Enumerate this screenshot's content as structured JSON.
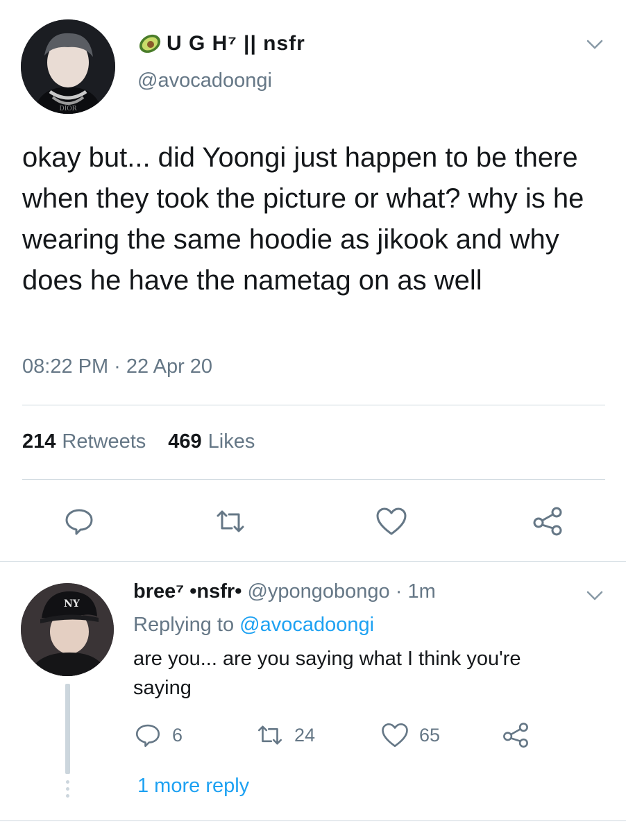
{
  "main_tweet": {
    "display_name": "U G H⁷ || nsfr",
    "handle": "@avocadoongi",
    "avatar_caption": "DIOR",
    "text": "okay but... did Yoongi just happen to be there when they took the picture or what? why is he wearing the same hoodie as jikook and why does he have the nametag on as well",
    "timestamp": "08:22 PM · 22 Apr 20",
    "retweet_count": "214",
    "retweet_label": "Retweets",
    "like_count": "469",
    "like_label": "Likes"
  },
  "reply_tweet": {
    "display_name": "bree⁷ •nsfr•",
    "handle": "@ypongobongo",
    "time": "· 1m",
    "replying_prefix": "Replying to",
    "replying_handle": "@avocadoongi",
    "text": "are you... are you saying what I think you're saying",
    "reply_count": "6",
    "retweet_count": "24",
    "like_count": "65",
    "more_replies": "1 more reply"
  },
  "colors": {
    "text": "#14171a",
    "muted": "#657786",
    "link": "#1da1f2",
    "divider": "#ccd6dd",
    "avocado_skin": "#4a7d2a",
    "avocado_flesh": "#c9dc6a"
  },
  "icons": [
    "avocado-icon",
    "chevron-down-icon",
    "reply-icon",
    "retweet-icon",
    "like-icon",
    "share-icon"
  ]
}
